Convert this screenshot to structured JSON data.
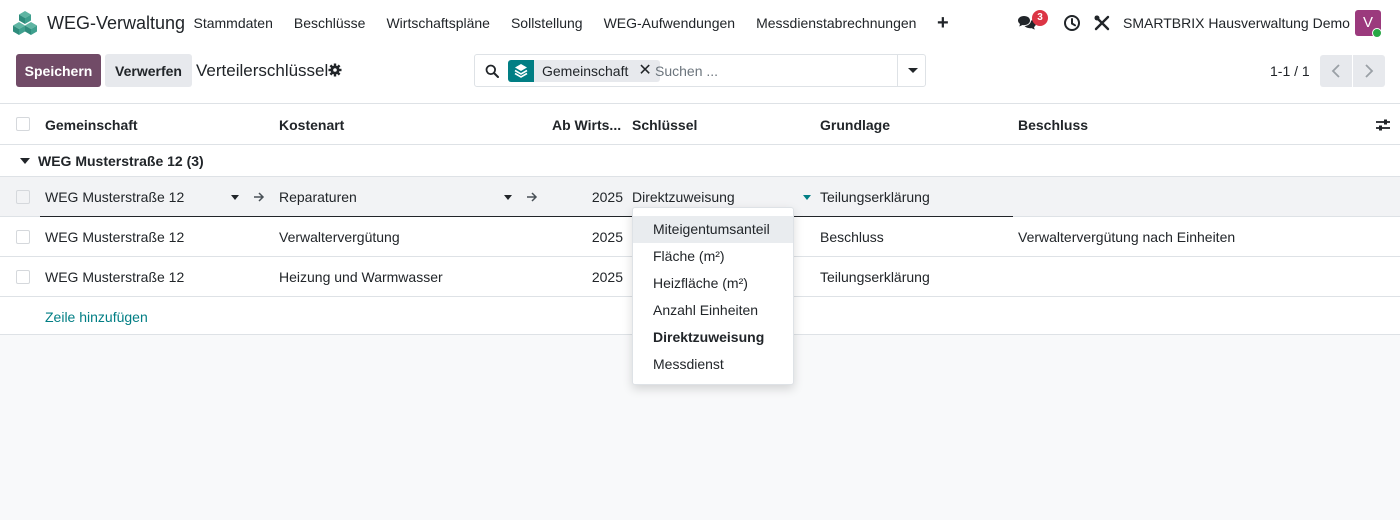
{
  "navbar": {
    "app_name": "WEG-Verwaltung",
    "menu": [
      "Stammdaten",
      "Beschlüsse",
      "Wirtschaftspläne",
      "Sollstellung",
      "WEG-Aufwendungen",
      "Messdienstabrechnungen"
    ],
    "plus_icon": "plus-icon",
    "chat_badge": "3",
    "company": "SMARTBRIX Hausverwaltung Demo",
    "avatar_letter": "V",
    "colors": {
      "brand": "#714b67",
      "accent": "#017e84",
      "badge": "#dc3545",
      "avatar": "#9b3a7d",
      "online": "#28a745"
    }
  },
  "control": {
    "save_label": "Speichern",
    "discard_label": "Verwerfen",
    "breadcrumb": "Verteilerschlüssel",
    "search": {
      "facet_label": "Gemeinschaft",
      "placeholder": "Suchen ..."
    },
    "pager": "1-1 / 1"
  },
  "list": {
    "columns": {
      "community": "Gemeinschaft",
      "cost_type": "Kostenart",
      "from_year": "Ab Wirts...",
      "key": "Schlüssel",
      "basis": "Grundlage",
      "resolution": "Beschluss"
    },
    "group": {
      "label": "WEG Musterstraße 12 (3)"
    },
    "rows": [
      {
        "community": "WEG Musterstraße 12",
        "cost_type": "Reparaturen",
        "from_year": "2025",
        "key": "Direktzuweisung",
        "basis": "Teilungserklärung",
        "resolution": ""
      },
      {
        "community": "WEG Musterstraße 12",
        "cost_type": "Verwaltervergütung",
        "from_year": "2025",
        "key": "",
        "basis": "Beschluss",
        "resolution": "Verwaltervergütung nach Einheiten"
      },
      {
        "community": "WEG Musterstraße 12",
        "cost_type": "Heizung und Warmwasser",
        "from_year": "2025",
        "key": "",
        "basis": "Teilungserklärung",
        "resolution": ""
      }
    ],
    "add_line": "Zeile hinzufügen"
  },
  "dropdown": {
    "options": [
      "Miteigentumsanteil",
      "Fläche (m²)",
      "Heizfläche (m²)",
      "Anzahl Einheiten",
      "Direktzuweisung",
      "Messdienst"
    ],
    "hovered": "Miteigentumsanteil",
    "selected": "Direktzuweisung"
  }
}
